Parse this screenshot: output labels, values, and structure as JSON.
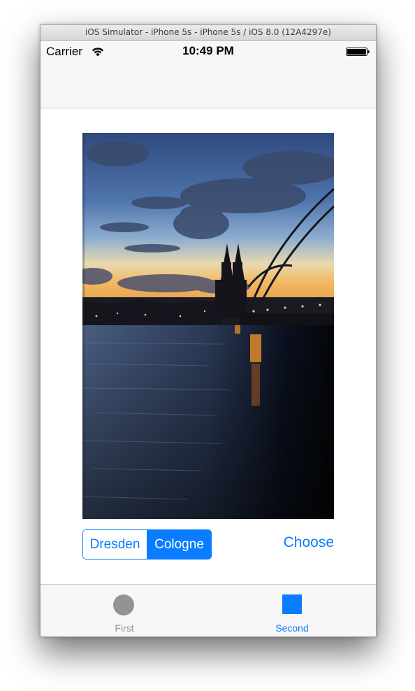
{
  "window": {
    "title": "iOS Simulator - iPhone 5s - iPhone 5s / iOS 8.0 (12A4297e)"
  },
  "status_bar": {
    "carrier": "Carrier",
    "time": "10:49 PM",
    "wifi_icon": "wifi-icon",
    "battery_icon": "battery-icon"
  },
  "segmented_control": {
    "options": [
      "Dresden",
      "Cologne"
    ],
    "selected": "Cologne"
  },
  "choose_button": {
    "label": "Choose"
  },
  "tab_bar": {
    "items": [
      {
        "label": "First",
        "icon": "circle-icon",
        "selected": false
      },
      {
        "label": "Second",
        "icon": "square-icon",
        "selected": true
      }
    ]
  },
  "colors": {
    "tint": "#0a7cff",
    "inactive": "#939393",
    "bar_background": "#f7f7f7"
  }
}
